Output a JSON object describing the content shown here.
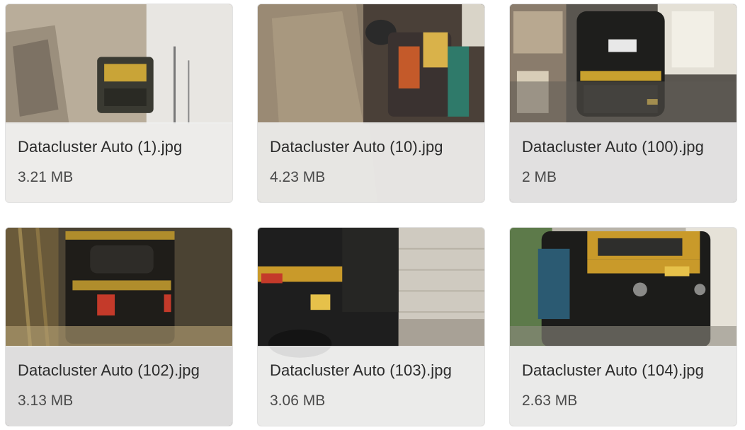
{
  "files": [
    {
      "name": "Datacluster Auto (1).jpg",
      "size": "3.21 MB",
      "thumbnail": "auto-rickshaw-road-daylight"
    },
    {
      "name": "Datacluster Auto (10).jpg",
      "size": "4.23 MB",
      "thumbnail": "auto-rickshaw-parked-dirt"
    },
    {
      "name": "Datacluster Auto (100).jpg",
      "size": "2 MB",
      "thumbnail": "auto-rickshaw-street-shops"
    },
    {
      "name": "Datacluster Auto (102).jpg",
      "size": "3.13 MB",
      "thumbnail": "auto-rickshaw-night-rear"
    },
    {
      "name": "Datacluster Auto (103).jpg",
      "size": "3.06 MB",
      "thumbnail": "auto-rickshaw-side-wall"
    },
    {
      "name": "Datacluster Auto (104).jpg",
      "size": "2.63 MB",
      "thumbnail": "auto-rickshaw-front"
    }
  ]
}
